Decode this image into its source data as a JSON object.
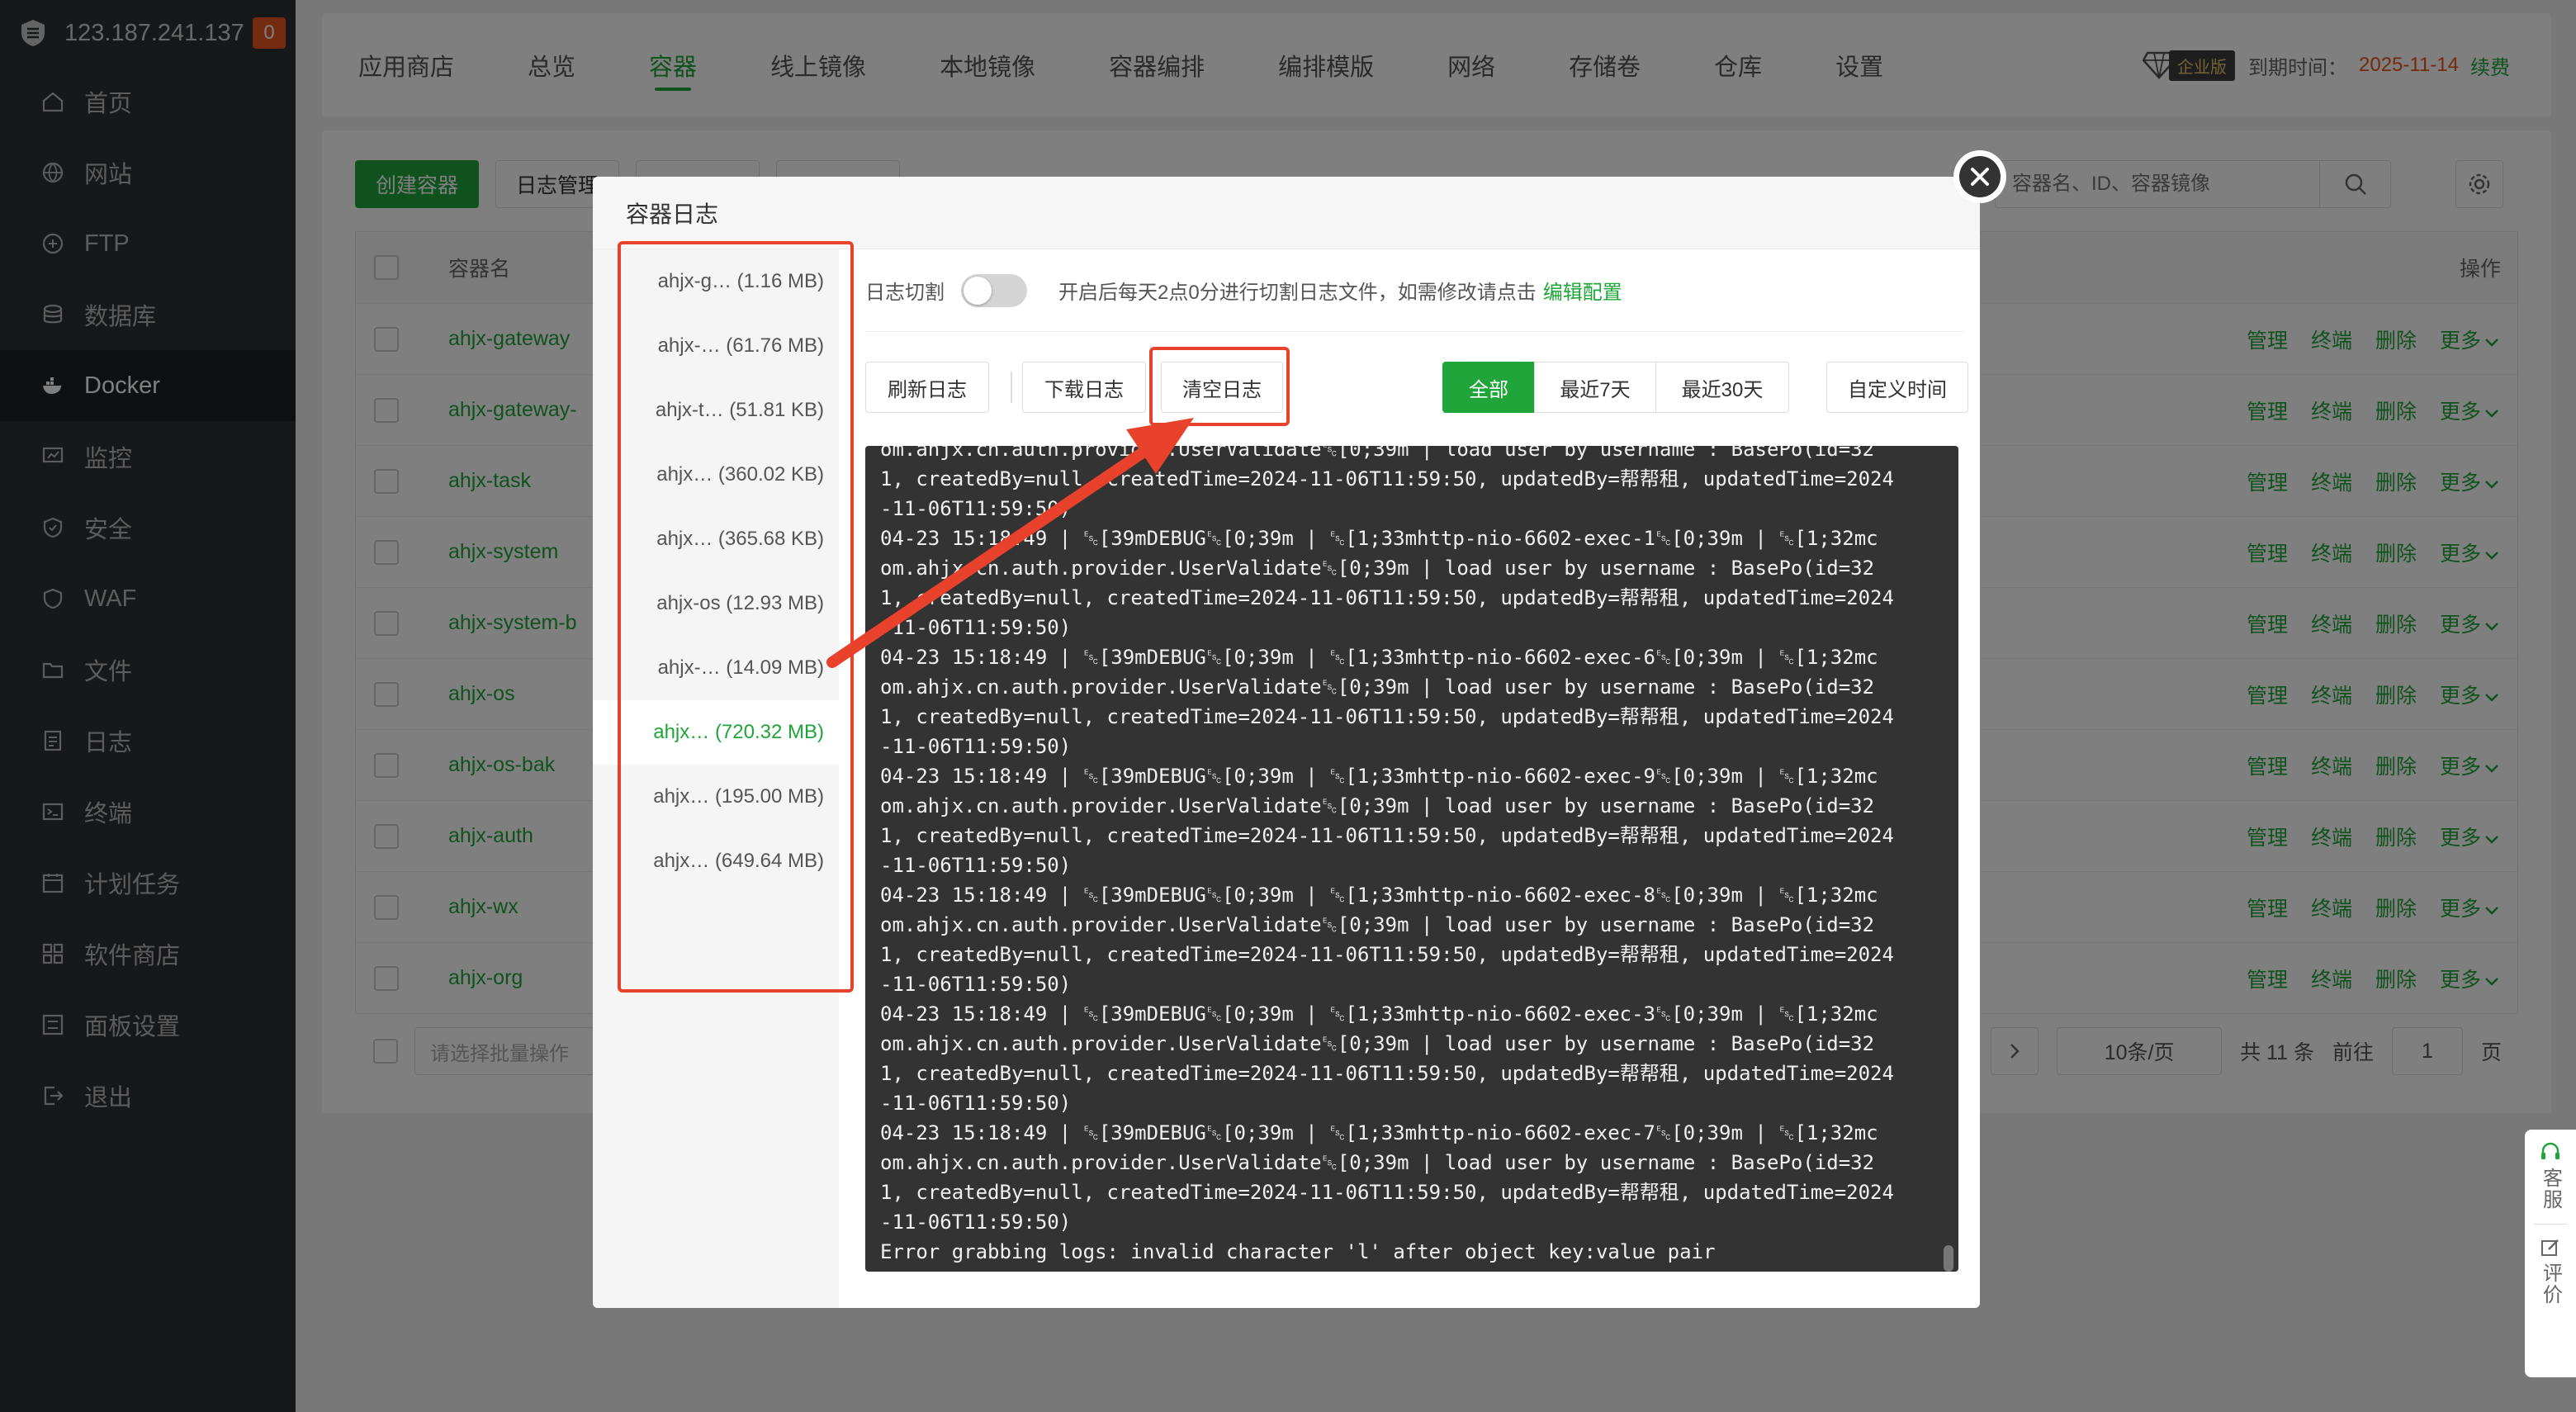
{
  "sidebar": {
    "ip": "123.187.241.137",
    "badge": "0",
    "items": [
      {
        "label": "首页",
        "icon": "home-icon"
      },
      {
        "label": "网站",
        "icon": "globe-icon"
      },
      {
        "label": "FTP",
        "icon": "ftp-icon"
      },
      {
        "label": "数据库",
        "icon": "database-icon"
      },
      {
        "label": "Docker",
        "icon": "docker-icon"
      },
      {
        "label": "监控",
        "icon": "monitor-icon"
      },
      {
        "label": "安全",
        "icon": "shield-icon"
      },
      {
        "label": "WAF",
        "icon": "waf-icon"
      },
      {
        "label": "文件",
        "icon": "folder-icon"
      },
      {
        "label": "日志",
        "icon": "log-icon"
      },
      {
        "label": "终端",
        "icon": "terminal-icon"
      },
      {
        "label": "计划任务",
        "icon": "calendar-icon"
      },
      {
        "label": "软件商店",
        "icon": "apps-icon"
      },
      {
        "label": "面板设置",
        "icon": "settings-icon"
      },
      {
        "label": "退出",
        "icon": "logout-icon"
      }
    ]
  },
  "topbar": {
    "tabs": [
      "应用商店",
      "总览",
      "容器",
      "线上镜像",
      "本地镜像",
      "容器编排",
      "编排模版",
      "网络",
      "存储卷",
      "仓库",
      "设置"
    ],
    "ent_label": "企业版",
    "expire_label": "到期时间：",
    "expire_date": "2025-11-14",
    "renew": "续费"
  },
  "main": {
    "create_btn": "创建容器",
    "log_btn": "日志管理",
    "search_placeholder": "容器名、ID、容器镜像",
    "col_name": "容器名",
    "col_ops": "操作",
    "rows": [
      "ahjx-gateway",
      "ahjx-gateway-",
      "ahjx-task",
      "ahjx-system",
      "ahjx-system-b",
      "ahjx-os",
      "ahjx-os-bak",
      "ahjx-auth",
      "ahjx-wx",
      "ahjx-org"
    ],
    "ops": {
      "manage": "管理",
      "term": "终端",
      "del": "删除",
      "more": "更多"
    },
    "batch_placeholder": "请选择批量操作",
    "page_size": "10条/页",
    "total": "共 11 条",
    "goto": "前往",
    "page": "1",
    "page_unit": "页"
  },
  "support": {
    "service": "客服",
    "rate": "评价"
  },
  "dialog": {
    "title": "容器日志",
    "list": [
      {
        "name": "ahjx-g…",
        "size": "(1.16 MB)"
      },
      {
        "name": "ahjx-…",
        "size": "(61.76 MB)"
      },
      {
        "name": "ahjx-t…",
        "size": "(51.81 KB)"
      },
      {
        "name": "ahjx…",
        "size": "(360.02 KB)"
      },
      {
        "name": "ahjx…",
        "size": "(365.68 KB)"
      },
      {
        "name": "ahjx-os",
        "size": "(12.93 MB)"
      },
      {
        "name": "ahjx-…",
        "size": "(14.09 MB)"
      },
      {
        "name": "ahjx…",
        "size": "(720.32 MB)"
      },
      {
        "name": "ahjx…",
        "size": "(195.00 MB)"
      },
      {
        "name": "ahjx…",
        "size": "(649.64 MB)"
      }
    ],
    "cut_label": "日志切割",
    "cut_desc": "开启后每天2点0分进行切割日志文件，如需修改请点击",
    "cut_link": "编辑配置",
    "refresh": "刷新日志",
    "download": "下载日志",
    "clear": "清空日志",
    "range": [
      "全部",
      "最近7天",
      "最近30天"
    ],
    "custom": "自定义时间",
    "log_text": "om.ahjx.cn.auth.provider.UserValidate␛[0;39m | load user by username : BasePo(id=32\n1, createdBy=null, createdTime=2024-11-06T11:59:50, updatedBy=帮帮租, updatedTime=2024\n-11-06T11:59:50)\n04-23 15:18:49 | ␛[39mDEBUG␛[0;39m | ␛[1;33mhttp-nio-6602-exec-1␛[0;39m | ␛[1;32mc\nom.ahjx.cn.auth.provider.UserValidate␛[0;39m | load user by username : BasePo(id=32\n1, createdBy=null, createdTime=2024-11-06T11:59:50, updatedBy=帮帮租, updatedTime=2024\n-11-06T11:59:50)\n04-23 15:18:49 | ␛[39mDEBUG␛[0;39m | ␛[1;33mhttp-nio-6602-exec-6␛[0;39m | ␛[1;32mc\nom.ahjx.cn.auth.provider.UserValidate␛[0;39m | load user by username : BasePo(id=32\n1, createdBy=null, createdTime=2024-11-06T11:59:50, updatedBy=帮帮租, updatedTime=2024\n-11-06T11:59:50)\n04-23 15:18:49 | ␛[39mDEBUG␛[0;39m | ␛[1;33mhttp-nio-6602-exec-9␛[0;39m | ␛[1;32mc\nom.ahjx.cn.auth.provider.UserValidate␛[0;39m | load user by username : BasePo(id=32\n1, createdBy=null, createdTime=2024-11-06T11:59:50, updatedBy=帮帮租, updatedTime=2024\n-11-06T11:59:50)\n04-23 15:18:49 | ␛[39mDEBUG␛[0;39m | ␛[1;33mhttp-nio-6602-exec-8␛[0;39m | ␛[1;32mc\nom.ahjx.cn.auth.provider.UserValidate␛[0;39m | load user by username : BasePo(id=32\n1, createdBy=null, createdTime=2024-11-06T11:59:50, updatedBy=帮帮租, updatedTime=2024\n-11-06T11:59:50)\n04-23 15:18:49 | ␛[39mDEBUG␛[0;39m | ␛[1;33mhttp-nio-6602-exec-3␛[0;39m | ␛[1;32mc\nom.ahjx.cn.auth.provider.UserValidate␛[0;39m | load user by username : BasePo(id=32\n1, createdBy=null, createdTime=2024-11-06T11:59:50, updatedBy=帮帮租, updatedTime=2024\n-11-06T11:59:50)\n04-23 15:18:49 | ␛[39mDEBUG␛[0;39m | ␛[1;33mhttp-nio-6602-exec-7␛[0;39m | ␛[1;32mc\nom.ahjx.cn.auth.provider.UserValidate␛[0;39m | load user by username : BasePo(id=32\n1, createdBy=null, createdTime=2024-11-06T11:59:50, updatedBy=帮帮租, updatedTime=2024\n-11-06T11:59:50)\nError grabbing logs: invalid character 'l' after object key:value pair"
  }
}
